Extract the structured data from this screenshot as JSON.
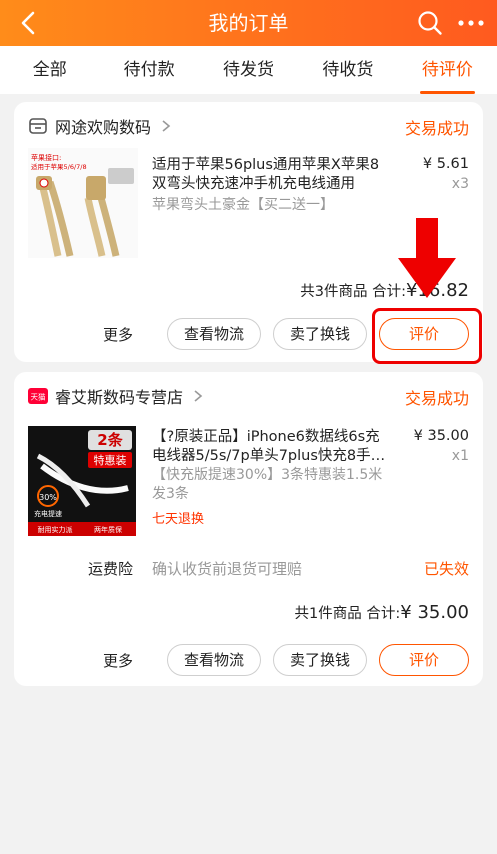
{
  "header": {
    "title": "我的订单",
    "back_icon": "back-arrow-icon",
    "search_icon": "search-icon",
    "more_icon": "more-dots-icon"
  },
  "tabs": [
    {
      "label": "全部"
    },
    {
      "label": "待付款"
    },
    {
      "label": "待发货"
    },
    {
      "label": "待收货"
    },
    {
      "label": "待评价",
      "active": true
    }
  ],
  "orders": [
    {
      "shop": "网途欢购数码",
      "status": "交易成功",
      "product": {
        "title": "适用于苹果56plus通用苹果X苹果8双弯头快充速冲手机充电线通用",
        "sku": "苹果弯头土豪金【买二送一】",
        "price": "¥ 5.61",
        "qty": "x3",
        "image_text": [
          "苹果接口:",
          "适用于苹果5/6/7/8"
        ]
      },
      "total_label": "共3件商品 合计:",
      "total_amount": "¥16.82",
      "actions": {
        "more": "更多",
        "logistics": "查看物流",
        "sell": "卖了换钱",
        "review": "评价"
      }
    },
    {
      "shop": "睿艾斯数码专营店",
      "shop_badge": "天猫",
      "status": "交易成功",
      "product": {
        "title": "【?原装正品】iPhone6数据线6s充电线器5/5s/7p单头7plus快充8手…",
        "sku": "【快充版提速30%】3条特惠装1.5米发3条",
        "price": "¥ 35.00",
        "qty": "x1",
        "tag": "七天退换",
        "image_text": [
          "2条",
          "特惠装",
          "30%",
          "充电提速",
          "耐用实力派",
          "两年质保"
        ]
      },
      "insurance": {
        "label": "运费险",
        "desc": "确认收货前退货可理赔",
        "status": "已失效"
      },
      "total_label": "共1件商品 合计:",
      "total_amount": "¥ 35.00",
      "actions": {
        "more": "更多",
        "logistics": "查看物流",
        "sell": "卖了换钱",
        "review": "评价"
      }
    }
  ],
  "colors": {
    "accent": "#ff5500",
    "header_start": "#ff8c1a",
    "header_end": "#ff5a1f",
    "annotation_red": "#ee0000"
  }
}
